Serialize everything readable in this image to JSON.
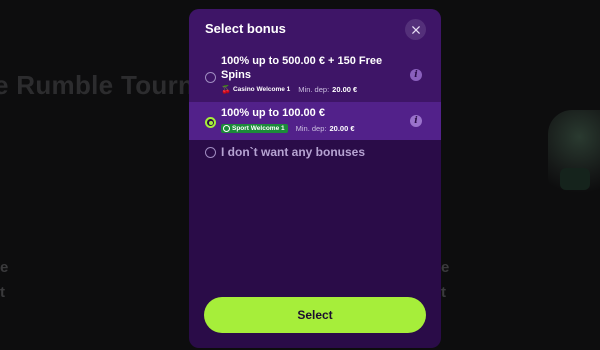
{
  "background": {
    "title": "e Rumble Tourn",
    "text_left_1": "e",
    "text_left_2": "t",
    "text_right_1": "e",
    "text_right_2": "t"
  },
  "modal": {
    "title": "Select bonus",
    "close_icon": "close-icon",
    "options": [
      {
        "title": "100% up to 500.00 € + 150 Free Spins",
        "tag": "Casino Welcome 1",
        "tag_icon": "cherry-icon",
        "min_dep_label": "Min. dep:",
        "min_dep_value": "20.00 €",
        "selected": false,
        "info_icon": "info-icon"
      },
      {
        "title": "100% up to 100.00 €",
        "tag": "Sport Welcome 1",
        "tag_icon": "soccer-ball-icon",
        "min_dep_label": "Min. dep:",
        "min_dep_value": "20.00 €",
        "selected": true,
        "info_icon": "info-icon"
      },
      {
        "title": "I don`t want any bonuses",
        "selected": false
      }
    ],
    "select_label": "Select"
  },
  "colors": {
    "modal_bg": "#2a0c48",
    "header_bg": "#3e1567",
    "selected_bg": "#52218a",
    "accent": "#a6ee3a",
    "sport_tag": "#1c8a3a"
  }
}
